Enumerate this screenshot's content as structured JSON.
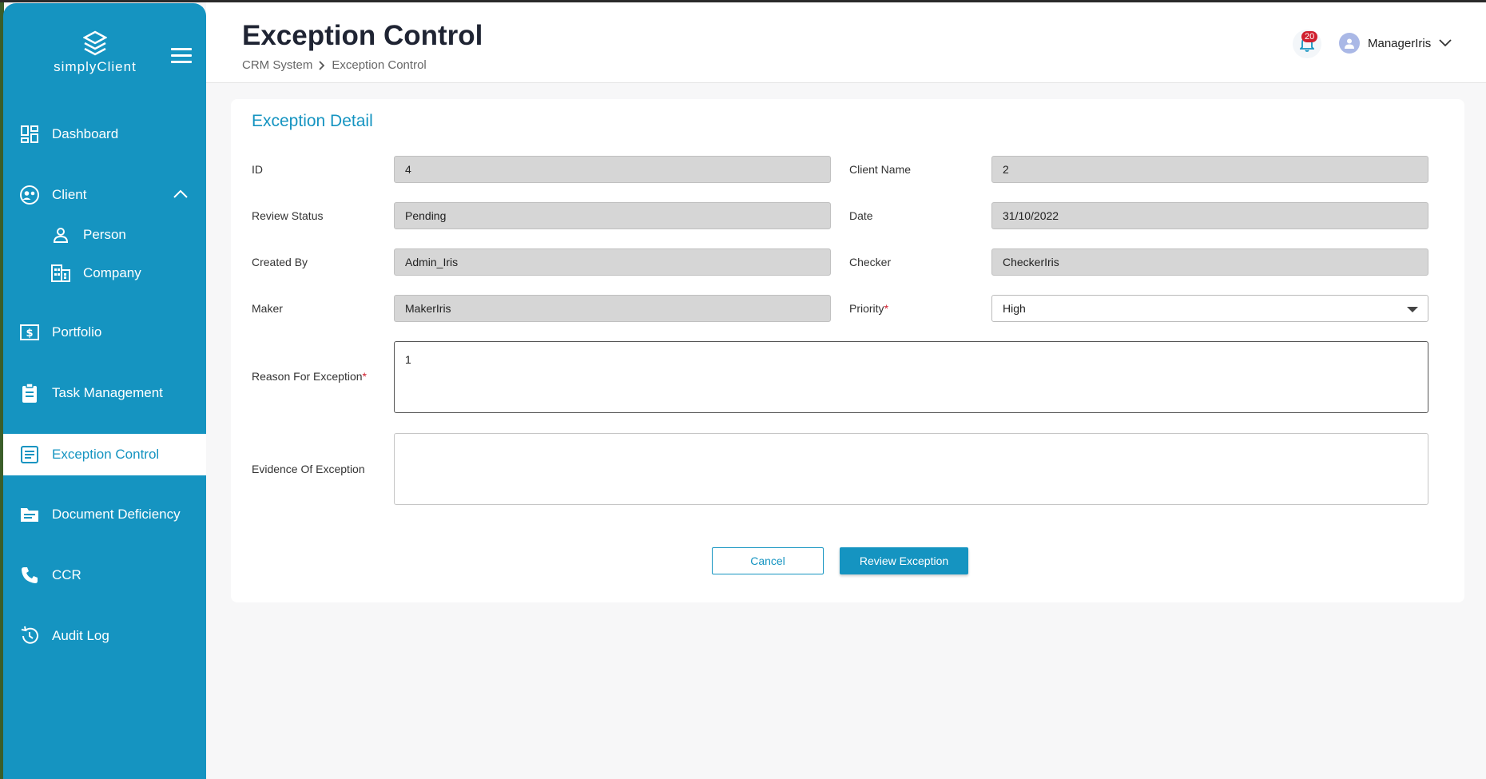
{
  "app": {
    "brand": "simplyClient"
  },
  "sidebar": {
    "items": [
      {
        "label": "Dashboard",
        "icon": "dashboard-icon"
      },
      {
        "label": "Client",
        "icon": "client-icon"
      },
      {
        "label": "Person",
        "icon": "person-icon"
      },
      {
        "label": "Company",
        "icon": "company-icon"
      },
      {
        "label": "Portfolio",
        "icon": "portfolio-icon"
      },
      {
        "label": "Task Management",
        "icon": "clipboard-icon"
      },
      {
        "label": "Exception Control",
        "icon": "document-icon"
      },
      {
        "label": "Document Deficiency",
        "icon": "folder-icon"
      },
      {
        "label": "CCR",
        "icon": "phone-icon"
      },
      {
        "label": "Audit Log",
        "icon": "history-icon"
      }
    ]
  },
  "header": {
    "title": "Exception Control",
    "breadcrumb": [
      "CRM System",
      "Exception Control"
    ],
    "notification_count": "20",
    "username": "ManagerIris"
  },
  "form": {
    "title": "Exception Detail",
    "id_label": "ID",
    "id_value": "4",
    "client_name_label": "Client Name",
    "client_name_value": "2",
    "review_status_label": "Review Status",
    "review_status_value": "Pending",
    "date_label": "Date",
    "date_value": "31/10/2022",
    "created_by_label": "Created By",
    "created_by_value": "Admin_Iris",
    "checker_label": "Checker",
    "checker_value": "CheckerIris",
    "maker_label": "Maker",
    "maker_value": "MakerIris",
    "priority_label": "Priority",
    "priority_value": "High",
    "reason_label": "Reason For Exception",
    "reason_value": "1",
    "evidence_label": "Evidence Of Exception",
    "evidence_value": "",
    "required_mark": "*",
    "cancel_label": "Cancel",
    "review_label": "Review Exception"
  }
}
